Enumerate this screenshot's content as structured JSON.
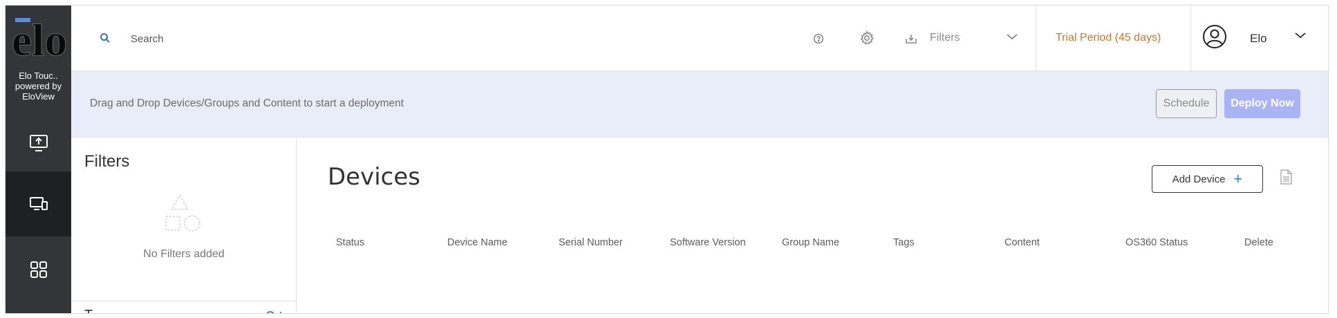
{
  "rail": {
    "logo_text": "elo",
    "org_line1": "Elo Touc..",
    "org_line2": "powered by",
    "org_line3": "EloView"
  },
  "header": {
    "search_placeholder": "Search",
    "filters_label": "Filters",
    "trial_text": "Trial Period (45 days)",
    "user_name": "Elo"
  },
  "deploy": {
    "message": "Drag and Drop Devices/Groups and Content to start a deployment",
    "schedule_label": "Schedule",
    "deploy_label": "Deploy Now"
  },
  "filters_panel": {
    "title": "Filters",
    "empty_text": "No Filters added"
  },
  "devices": {
    "title": "Devices",
    "add_label": "Add Device",
    "columns": [
      "Status",
      "Device Name",
      "Serial Number",
      "Software Version",
      "Group Name",
      "Tags",
      "Content",
      "OS360 Status",
      "Delete"
    ]
  },
  "colors": {
    "rail_bg": "#333538",
    "rail_active": "#1f2022",
    "trial": "#c7762a",
    "deploy_button": "#a9b4f6",
    "deploy_bar": "#e9edf7",
    "accent_blue": "#2f7bd6"
  },
  "icons": {
    "rail": [
      "upload-screen-icon",
      "devices-icon",
      "apps-grid-icon"
    ],
    "header": [
      "search-icon",
      "help-icon",
      "gear-icon",
      "download-icon",
      "chevron-down-icon",
      "user-icon"
    ]
  }
}
